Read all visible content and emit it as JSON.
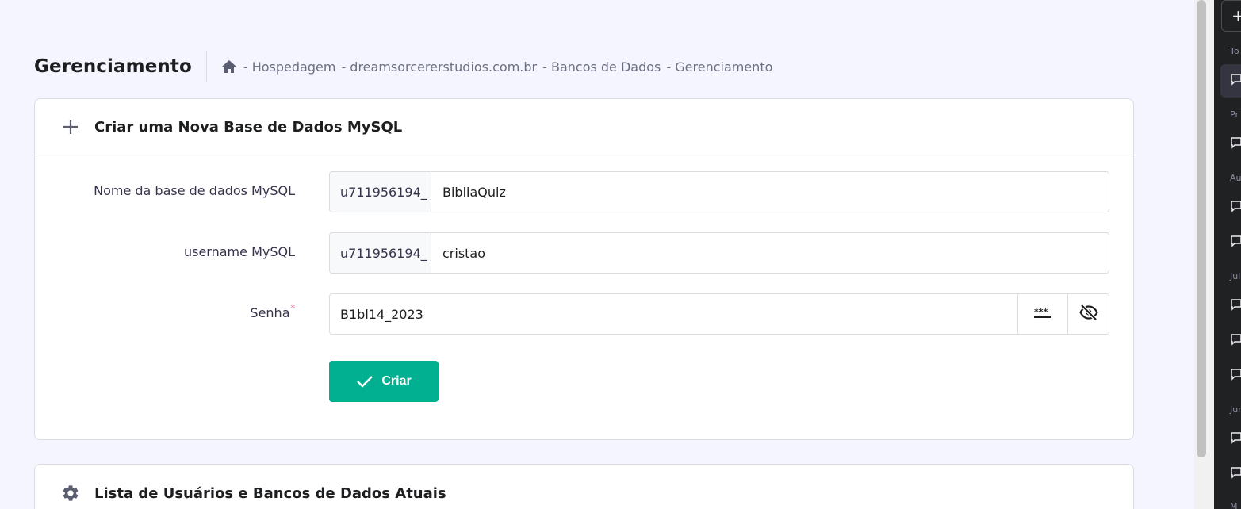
{
  "header": {
    "title": "Gerenciamento",
    "breadcrumb": [
      "- Hospedagem",
      "- dreamsorcererstudios.com.br",
      "- Bancos de Dados",
      "- Gerenciamento"
    ]
  },
  "create_card": {
    "title": "Criar uma Nova Base de Dados MySQL",
    "db_name": {
      "label": "Nome da base de dados MySQL",
      "prefix": "u711956194_",
      "value": "BibliaQuiz"
    },
    "username": {
      "label": "username MySQL",
      "prefix": "u711956194_",
      "value": "cristao"
    },
    "password": {
      "label": "Senha",
      "required_mark": "*",
      "value": "B1bl14_2023"
    },
    "submit_label": "Criar"
  },
  "list_card": {
    "title": "Lista de Usuários e Bancos de Dados Atuais"
  },
  "side_panel": {
    "new_chat_symbol": "+",
    "section_labels": [
      "To",
      "Pr",
      "Au",
      "Jul",
      "Jun",
      "M"
    ]
  },
  "colors": {
    "accent": "#00b090",
    "background": "#f4f5ff",
    "required": "#fc5185",
    "panel": "#202123"
  }
}
